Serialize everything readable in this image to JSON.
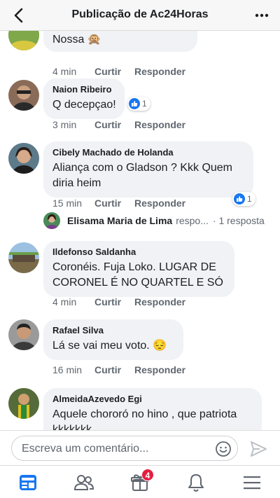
{
  "header": {
    "title": "Publicação de Ac24Horas"
  },
  "comments": [
    {
      "author": "",
      "text": "Nossa 🙊",
      "time": "4 min",
      "like": "Curtir",
      "reply": "Responder"
    },
    {
      "author": "Naion Ribeiro",
      "text": "Q decepçao!",
      "time": "3 min",
      "like": "Curtir",
      "reply": "Responder",
      "reactions": "1"
    },
    {
      "author": "Cibely Machado de Holanda",
      "text_line1": "Aliança com o Gladson ? Kkk Quem",
      "text_line2": "diria heim",
      "time": "15 min",
      "like": "Curtir",
      "reply": "Responder",
      "reactions": "1"
    },
    {
      "author": "Ildefonso Saldanha",
      "text_line1": "Coronéis. Fuja Loko. LUGAR DE",
      "text_line2": "CORONEL É NO QUARTEL E SÓ",
      "time": "4 min",
      "like": "Curtir",
      "reply": "Responder"
    },
    {
      "author": "Rafael Silva",
      "text": "Lá se vai meu voto. 😔",
      "time": "16 min",
      "like": "Curtir",
      "reply": "Responder"
    },
    {
      "author": "AlmeidaAzevedo Egi",
      "text_line1": "Aquele chororó no hino , que patriota",
      "text_line2": "kkkkkkk"
    }
  ],
  "reply_preview": {
    "name": "Elisama Maria de Lima",
    "snippet": "respo...",
    "count": "· 1 resposta"
  },
  "composer": {
    "placeholder": "Escreva um comentário..."
  },
  "tabbar": {
    "notifications_badge": "4"
  },
  "colors": {
    "brand": "#1877f2",
    "badge": "#e41e3f",
    "bubble": "#f0f2f5"
  }
}
